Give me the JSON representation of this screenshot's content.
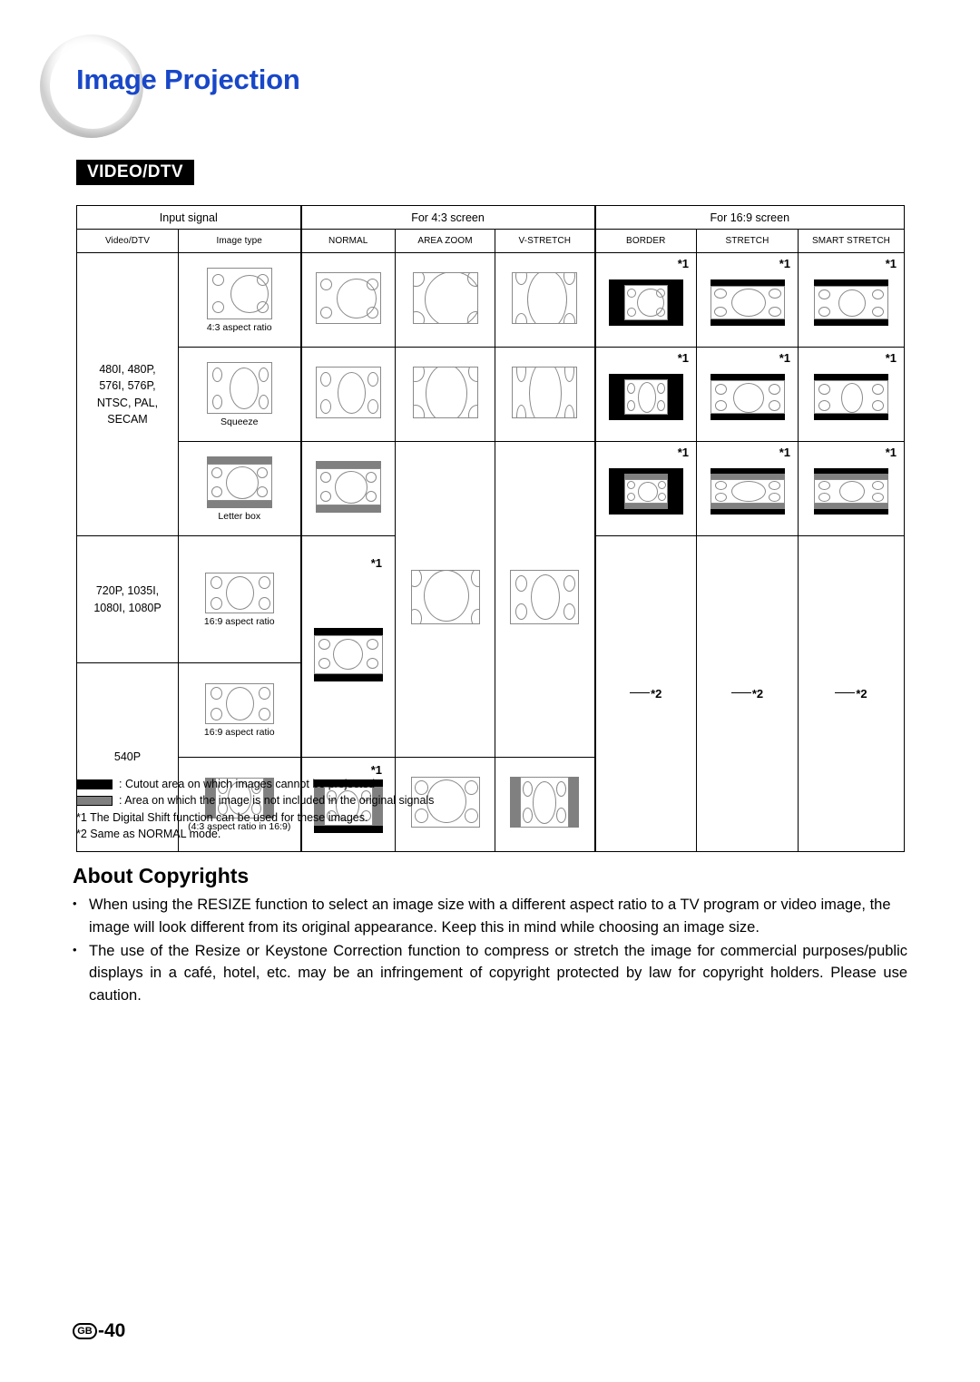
{
  "header": {
    "title": "Image Projection",
    "section_tag": "VIDEO/DTV"
  },
  "table": {
    "group_headers": {
      "input_signal": "Input signal",
      "for_4_3": "For 4:3 screen",
      "for_16_9": "For 16:9 screen"
    },
    "sub_headers": {
      "video_dtv": "Video/DTV",
      "image_type": "Image type",
      "normal": "NORMAL",
      "area_zoom": "AREA ZOOM",
      "v_stretch": "V-STRETCH",
      "border": "BORDER",
      "stretch": "STRETCH",
      "smart_stretch": "SMART STRETCH"
    },
    "signals": {
      "sd": "480I, 480P,\n576I, 576P,\nNTSC, PAL,\nSECAM",
      "sd_line1": "480I, 480P,",
      "sd_line2": "576I, 576P,",
      "sd_line3": "NTSC, PAL,",
      "sd_line4": "SECAM",
      "hd_line1": "720P, 1035I,",
      "hd_line2": "1080I, 1080P",
      "p540": "540P"
    },
    "image_types": {
      "aspect_4_3": "4:3 aspect ratio",
      "squeeze": "Squeeze",
      "letter_box": "Letter box",
      "aspect_16_9": "16:9 aspect ratio",
      "aspect_4_3_in_16_9": "(4:3 aspect ratio in 16:9)"
    },
    "marks": {
      "star1": "*1",
      "star2": "*2"
    }
  },
  "legend": {
    "cutout": ": Cutout area on which images cannot be projected",
    "notincluded": ": Area on which the image is not included in the original signals",
    "note1": "*1 The Digital Shift function can be used for these images.",
    "note2": "*2 Same as NORMAL mode."
  },
  "copyrights": {
    "title": "About Copyrights",
    "bullet_marker": "•",
    "bullet1": "When using the RESIZE function to select an image size with a different aspect ratio to a TV program or video image, the image will look different from its original appearance. Keep this in mind while choosing an image size.",
    "bullet2": "The use of the Resize or Keystone Correction function to compress or stretch the image for commercial purposes/public displays in a café, hotel, etc. may be an infringement of copyright protected by law for copyright holders. Please use caution."
  },
  "footer": {
    "region_code": "GB",
    "page_number": "-40"
  },
  "colors": {
    "title_blue": "#1847c8",
    "cutout_black": "#000000",
    "notincluded_gray": "#808080",
    "figure_outline": "#8a8a8a"
  }
}
